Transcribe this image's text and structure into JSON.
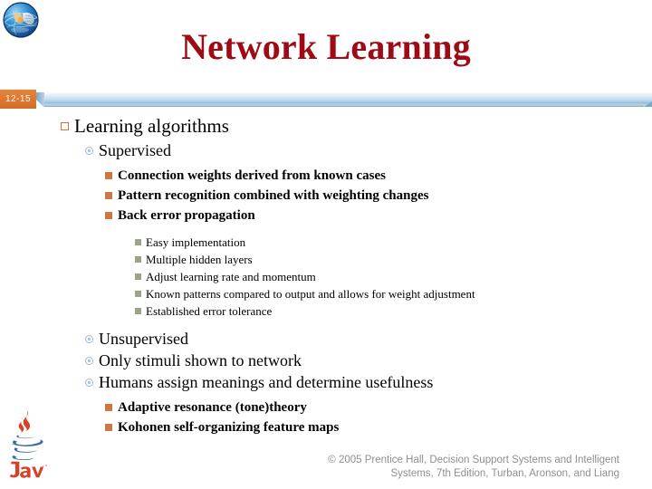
{
  "slide": {
    "title": "Network Learning",
    "page_badge": "12-15",
    "title_color": "#9E0B14",
    "badge_color": "#DD7730",
    "band_color": "#A7C6DE",
    "background": "#FFFFFF"
  },
  "logos": {
    "top_left": "globe-hand-icon",
    "bottom_left": "java-logo",
    "java_wordmark": "Java"
  },
  "outline": [
    {
      "level": 1,
      "marker": "open-square-bullet",
      "text": "Learning algorithms"
    },
    {
      "level": 2,
      "marker": "circle-dot-bullet",
      "text": "Supervised"
    },
    {
      "level": 3,
      "marker": "filled-square-bullet",
      "text": "Connection weights derived from known cases"
    },
    {
      "level": 3,
      "marker": "filled-square-bullet",
      "text": "Pattern recognition combined with weighting changes"
    },
    {
      "level": 3,
      "marker": "filled-square-bullet",
      "text": "Back error propagation"
    },
    {
      "level": 4,
      "marker": "filled-square-bullet",
      "text": "Easy implementation"
    },
    {
      "level": 4,
      "marker": "filled-square-bullet",
      "text": "Multiple hidden layers"
    },
    {
      "level": 4,
      "marker": "filled-square-bullet",
      "text": "Adjust learning rate and momentum"
    },
    {
      "level": 4,
      "marker": "filled-square-bullet",
      "text": "Known patterns compared to output and allows for weight adjustment"
    },
    {
      "level": 4,
      "marker": "filled-square-bullet",
      "text": "Established error tolerance"
    },
    {
      "level": 2,
      "marker": "circle-dot-bullet",
      "text": "Unsupervised"
    },
    {
      "level": 2,
      "marker": "circle-dot-bullet",
      "text": "Only stimuli shown to network"
    },
    {
      "level": 2,
      "marker": "circle-dot-bullet",
      "text": "Humans assign meanings and determine usefulness"
    },
    {
      "level": 3,
      "marker": "filled-square-bullet",
      "text": "Adaptive resonance (tone)theory"
    },
    {
      "level": 3,
      "marker": "filled-square-bullet",
      "text": "Kohonen self-organizing feature maps"
    }
  ],
  "footer": {
    "line1": "© 2005  Prentice Hall, Decision Support Systems and Intelligent",
    "line2": "Systems, 7th Edition, Turban, Aronson, and Liang"
  }
}
